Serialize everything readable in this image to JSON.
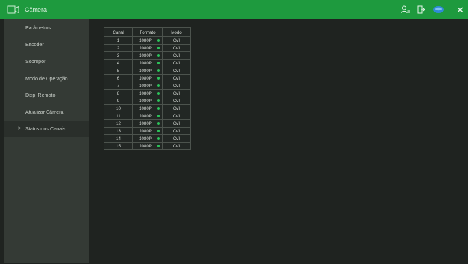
{
  "window": {
    "title": "Câmera"
  },
  "colors": {
    "accent": "#1e9a3e",
    "status_ok": "#2dc25a",
    "sidebar_bg": "#343a35",
    "content_bg": "#1f2320"
  },
  "toolbar_icons": [
    "user-icon",
    "logout-icon",
    "cloud-icon",
    "close-icon"
  ],
  "sidebar": {
    "items": [
      {
        "label": "Parâmetros",
        "active": false
      },
      {
        "label": "Encoder",
        "active": false
      },
      {
        "label": "Sobrepor",
        "active": false
      },
      {
        "label": "Modo de Operação",
        "active": false
      },
      {
        "label": "Disp. Remoto",
        "active": false
      },
      {
        "label": "Atualizar Câmera",
        "active": false
      },
      {
        "label": "Status dos Canais",
        "active": true,
        "caret": ">"
      }
    ]
  },
  "table": {
    "headers": {
      "canal": "Canal",
      "formato": "Formato",
      "modo": "Modo"
    },
    "rows": [
      {
        "canal": "1",
        "formato": "1080P",
        "modo": "CVI"
      },
      {
        "canal": "2",
        "formato": "1080P",
        "modo": "CVI"
      },
      {
        "canal": "3",
        "formato": "1080P",
        "modo": "CVI"
      },
      {
        "canal": "4",
        "formato": "1080P",
        "modo": "CVI"
      },
      {
        "canal": "5",
        "formato": "1080P",
        "modo": "CVI"
      },
      {
        "canal": "6",
        "formato": "1080P",
        "modo": "CVI"
      },
      {
        "canal": "7",
        "formato": "1080P",
        "modo": "CVI"
      },
      {
        "canal": "8",
        "formato": "1080P",
        "modo": "CVI"
      },
      {
        "canal": "9",
        "formato": "1080P",
        "modo": "CVI"
      },
      {
        "canal": "10",
        "formato": "1080P",
        "modo": "CVI"
      },
      {
        "canal": "11",
        "formato": "1080P",
        "modo": "CVI"
      },
      {
        "canal": "12",
        "formato": "1080P",
        "modo": "CVI"
      },
      {
        "canal": "13",
        "formato": "1080P",
        "modo": "CVI"
      },
      {
        "canal": "14",
        "formato": "1080P",
        "modo": "CVI"
      },
      {
        "canal": "15",
        "formato": "1080P",
        "modo": "CVI"
      }
    ]
  }
}
